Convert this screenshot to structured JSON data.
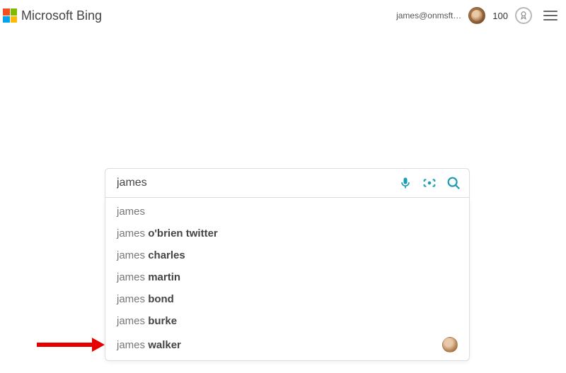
{
  "header": {
    "brand": "Microsoft Bing",
    "account_email": "james@onmsft…",
    "rewards_points": "100"
  },
  "search": {
    "value": "james",
    "placeholder": ""
  },
  "suggestions": [
    {
      "prefix": "james",
      "completion": "",
      "hasAvatar": false
    },
    {
      "prefix": "james ",
      "completion": "o'brien twitter",
      "hasAvatar": false
    },
    {
      "prefix": "james ",
      "completion": "charles",
      "hasAvatar": false
    },
    {
      "prefix": "james ",
      "completion": "martin",
      "hasAvatar": false
    },
    {
      "prefix": "james ",
      "completion": "bond",
      "hasAvatar": false
    },
    {
      "prefix": "james ",
      "completion": "burke",
      "hasAvatar": false
    },
    {
      "prefix": "james ",
      "completion": "walker",
      "hasAvatar": true
    }
  ]
}
